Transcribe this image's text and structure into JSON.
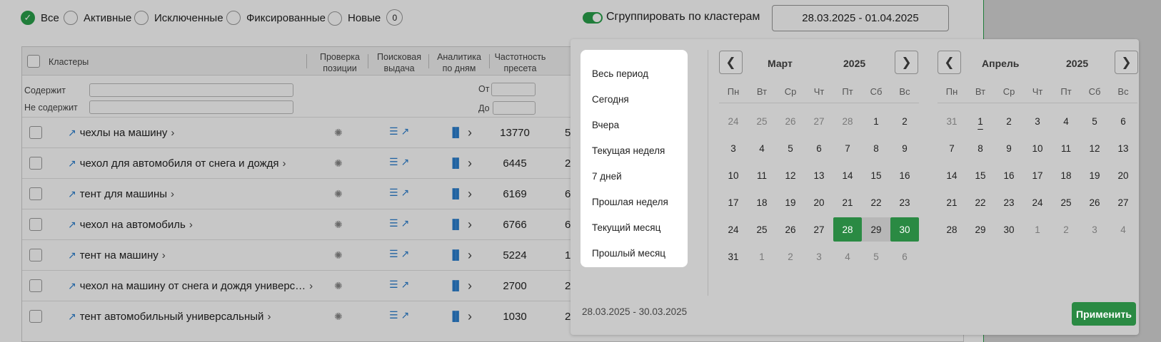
{
  "filters": [
    {
      "label": "Все",
      "checked": true
    },
    {
      "label": "Активные",
      "checked": false
    },
    {
      "label": "Исключенные",
      "checked": false
    },
    {
      "label": "Фиксированные",
      "checked": false
    },
    {
      "label": "Новые",
      "checked": false,
      "count": "0"
    }
  ],
  "group": {
    "label": "Сгруппировать по кластерам",
    "enabled": true
  },
  "date_input": "28.03.2025 - 01.04.2025",
  "table": {
    "headers": {
      "clusters": "Кластеры",
      "position_check": [
        "Проверка",
        "позиции"
      ],
      "search_results": [
        "Поисковая",
        "выдача"
      ],
      "analytics": [
        "Аналитика",
        "по дням"
      ],
      "frequency": [
        "Частотность",
        "пресета"
      ]
    },
    "filters": {
      "contains": "Содержит",
      "not_contains": "Не содержит",
      "from": "От",
      "to": "До"
    },
    "rows": [
      {
        "name": "чехлы на машину",
        "freq": "13770",
        "cut": "5("
      },
      {
        "name": "чехол для автомобиля от снега и дождя",
        "freq": "6445",
        "cut": "2("
      },
      {
        "name": "тент для машины",
        "freq": "6169",
        "cut": "6("
      },
      {
        "name": "чехол на автомобиль",
        "freq": "6766",
        "cut": "6("
      },
      {
        "name": "тент на машину",
        "freq": "5224",
        "cut": "1"
      },
      {
        "name": "чехол на машину от снега и дождя универс…",
        "freq": "2700",
        "cut": "2("
      },
      {
        "name": "тент автомобильный универсальный",
        "freq": "1030",
        "cut": "2("
      }
    ]
  },
  "datepicker": {
    "presets": [
      "Весь период",
      "Сегодня",
      "Вчера",
      "Текущая неделя",
      "7 дней",
      "Прошлая неделя",
      "Текущий месяц",
      "Прошлый месяц"
    ],
    "weekdays": [
      "Пн",
      "Вт",
      "Ср",
      "Чт",
      "Пт",
      "Сб",
      "Вс"
    ],
    "left": {
      "month": "Март",
      "year": "2025",
      "days": [
        {
          "d": "24",
          "t": "o"
        },
        {
          "d": "25",
          "t": "o"
        },
        {
          "d": "26",
          "t": "o"
        },
        {
          "d": "27",
          "t": "o"
        },
        {
          "d": "28",
          "t": "o"
        },
        {
          "d": "1",
          "t": "c"
        },
        {
          "d": "2",
          "t": "c"
        },
        {
          "d": "3",
          "t": "c"
        },
        {
          "d": "4",
          "t": "c"
        },
        {
          "d": "5",
          "t": "c"
        },
        {
          "d": "6",
          "t": "c"
        },
        {
          "d": "7",
          "t": "c"
        },
        {
          "d": "8",
          "t": "c"
        },
        {
          "d": "9",
          "t": "c"
        },
        {
          "d": "10",
          "t": "c"
        },
        {
          "d": "11",
          "t": "c"
        },
        {
          "d": "12",
          "t": "c"
        },
        {
          "d": "13",
          "t": "c"
        },
        {
          "d": "14",
          "t": "c"
        },
        {
          "d": "15",
          "t": "c"
        },
        {
          "d": "16",
          "t": "c"
        },
        {
          "d": "17",
          "t": "c"
        },
        {
          "d": "18",
          "t": "c"
        },
        {
          "d": "19",
          "t": "c"
        },
        {
          "d": "20",
          "t": "c"
        },
        {
          "d": "21",
          "t": "c"
        },
        {
          "d": "22",
          "t": "c"
        },
        {
          "d": "23",
          "t": "c"
        },
        {
          "d": "24",
          "t": "c"
        },
        {
          "d": "25",
          "t": "c"
        },
        {
          "d": "26",
          "t": "c"
        },
        {
          "d": "27",
          "t": "c"
        },
        {
          "d": "28",
          "t": "sel"
        },
        {
          "d": "29",
          "t": "mid"
        },
        {
          "d": "30",
          "t": "sel"
        },
        {
          "d": "31",
          "t": "cur"
        },
        {
          "d": "1",
          "t": "o"
        },
        {
          "d": "2",
          "t": "o"
        },
        {
          "d": "3",
          "t": "o"
        },
        {
          "d": "4",
          "t": "o"
        },
        {
          "d": "5",
          "t": "o"
        },
        {
          "d": "6",
          "t": "o"
        }
      ]
    },
    "right": {
      "month": "Апрель",
      "year": "2025",
      "days": [
        {
          "d": "31",
          "t": "o"
        },
        {
          "d": "1",
          "t": "today"
        },
        {
          "d": "2",
          "t": "c"
        },
        {
          "d": "3",
          "t": "c"
        },
        {
          "d": "4",
          "t": "c"
        },
        {
          "d": "5",
          "t": "c"
        },
        {
          "d": "6",
          "t": "c"
        },
        {
          "d": "7",
          "t": "c"
        },
        {
          "d": "8",
          "t": "c"
        },
        {
          "d": "9",
          "t": "c"
        },
        {
          "d": "10",
          "t": "c"
        },
        {
          "d": "11",
          "t": "c"
        },
        {
          "d": "12",
          "t": "c"
        },
        {
          "d": "13",
          "t": "c"
        },
        {
          "d": "14",
          "t": "c"
        },
        {
          "d": "15",
          "t": "c"
        },
        {
          "d": "16",
          "t": "c"
        },
        {
          "d": "17",
          "t": "c"
        },
        {
          "d": "18",
          "t": "c"
        },
        {
          "d": "19",
          "t": "c"
        },
        {
          "d": "20",
          "t": "c"
        },
        {
          "d": "21",
          "t": "c"
        },
        {
          "d": "22",
          "t": "c"
        },
        {
          "d": "23",
          "t": "c"
        },
        {
          "d": "24",
          "t": "c"
        },
        {
          "d": "25",
          "t": "c"
        },
        {
          "d": "26",
          "t": "c"
        },
        {
          "d": "27",
          "t": "c"
        },
        {
          "d": "28",
          "t": "c"
        },
        {
          "d": "29",
          "t": "c"
        },
        {
          "d": "30",
          "t": "c"
        },
        {
          "d": "1",
          "t": "o"
        },
        {
          "d": "2",
          "t": "o"
        },
        {
          "d": "3",
          "t": "o"
        },
        {
          "d": "4",
          "t": "o"
        }
      ]
    },
    "selected_range": "28.03.2025 - 30.03.2025",
    "apply_label": "Применить"
  },
  "colors": {
    "accent": "#2aa14b",
    "selected": "#2a8a43",
    "link": "#2a7fd0"
  },
  "icons": {
    "check": "check-icon",
    "external": "external-link-icon",
    "spinner": "spinner-icon",
    "list": "list-icon",
    "bars": "bar-chart-icon",
    "chevron": "chevron-right-icon"
  }
}
